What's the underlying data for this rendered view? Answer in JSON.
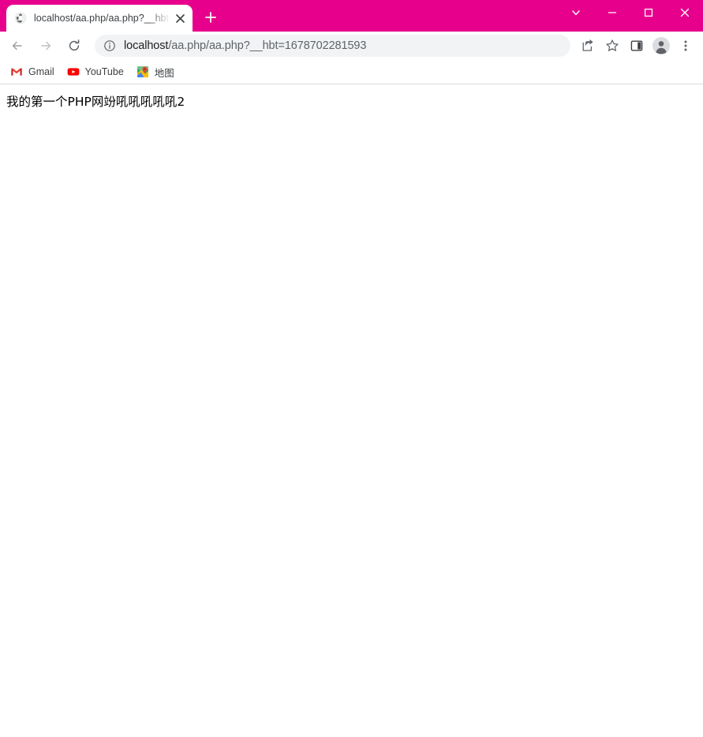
{
  "window": {
    "titlebar_color": "#e6008c",
    "controls": [
      {
        "name": "tab-search",
        "glyph": "chevron-down"
      },
      {
        "name": "minimize",
        "glyph": "minimize"
      },
      {
        "name": "maximize",
        "glyph": "maximize"
      },
      {
        "name": "close",
        "glyph": "close"
      }
    ]
  },
  "tabstrip": {
    "tabs": [
      {
        "title": "localhost/aa.php/aa.php?__hbt",
        "favicon": "globe-icon",
        "close_label": "×",
        "active": true
      }
    ],
    "new_tab_label": "+"
  },
  "toolbar": {
    "back_label": "←",
    "forward_label": "→",
    "reload_label": "⟳",
    "actions": [
      {
        "name": "share-icon"
      },
      {
        "name": "bookmark-star-icon"
      },
      {
        "name": "side-panel-icon"
      },
      {
        "name": "profile-avatar"
      },
      {
        "name": "chrome-menu-icon"
      }
    ]
  },
  "omnibox": {
    "info_icon": "info-circle-icon",
    "host": "localhost",
    "path": "/aa.php/aa.php?__hbt=1678702281593",
    "full_url": "localhost/aa.php/aa.php?__hbt=1678702281593"
  },
  "bookmarks": {
    "items": [
      {
        "label": "Gmail",
        "icon": "gmail-icon"
      },
      {
        "label": "YouTube",
        "icon": "youtube-icon"
      },
      {
        "label": "地图",
        "icon": "google-maps-icon"
      }
    ]
  },
  "page": {
    "body_text": "我的第一个PHP网竕吼吼吼吼吼2",
    "background": "#ffffff"
  }
}
